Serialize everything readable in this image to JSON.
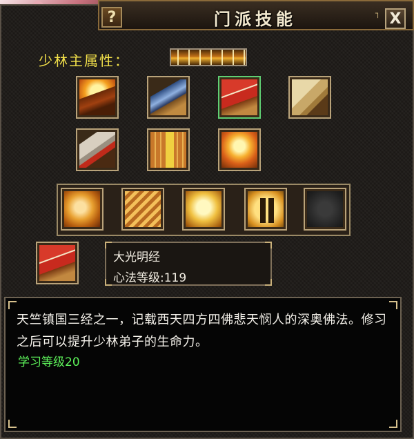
{
  "window": {
    "title": "门派技能",
    "help_label": "?",
    "close_label": "X"
  },
  "attribute": {
    "label": "少林主属性："
  },
  "skill_icons": [
    {
      "name": "book-fire",
      "selected": false
    },
    {
      "name": "book-blue",
      "selected": false
    },
    {
      "name": "book-red",
      "selected": true
    },
    {
      "name": "scroll-map",
      "selected": false
    },
    {
      "name": "scroll-red",
      "selected": false
    },
    {
      "name": "book-gold",
      "selected": false
    },
    {
      "name": "book-flame",
      "selected": false
    }
  ],
  "skillbar": [
    {
      "name": "lion-icon"
    },
    {
      "name": "wing-icon"
    },
    {
      "name": "buddha-icon"
    },
    {
      "name": "fighters-icon"
    },
    {
      "name": "empty-slot"
    }
  ],
  "selected_skill": {
    "name": "大光明经",
    "level_text": "心法等级:119"
  },
  "description": {
    "text": "天竺镇国三经之一，记载西天四方四佛悲天悯人的深奥佛法。修习之后可以提升少林弟子的生命力。",
    "learn_level": "学习等级20"
  },
  "colors": {
    "label_yellow": "#f2e04a",
    "learn_green": "#5df25a",
    "selected_border": "#5fcf73"
  }
}
